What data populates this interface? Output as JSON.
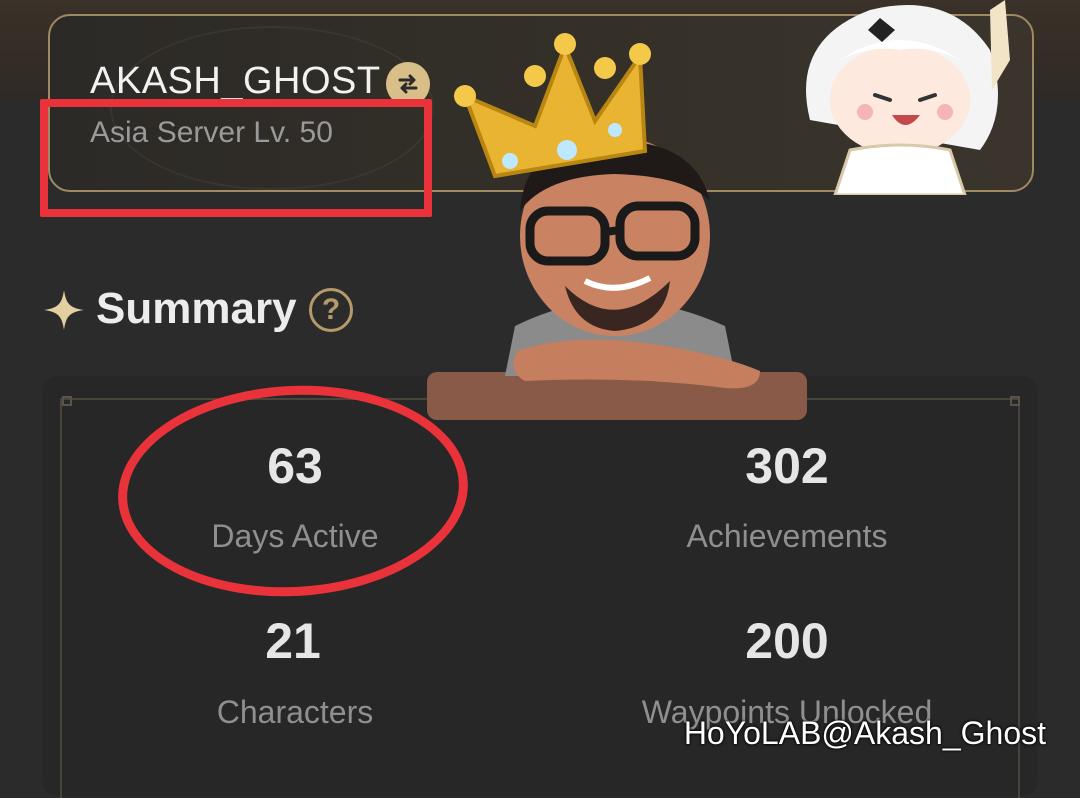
{
  "profile": {
    "username": "AKASH_GHOST",
    "server_level": "Asia Server Lv. 50"
  },
  "summary": {
    "title": "Summary"
  },
  "stats": [
    {
      "value": "63",
      "label": "Days Active"
    },
    {
      "value": "302",
      "label": "Achievements"
    },
    {
      "value": "21",
      "label": "Characters"
    },
    {
      "value": "200",
      "label": "Waypoints Unlocked"
    }
  ],
  "watermark": "HoYoLAB@Akash_Ghost",
  "colors": {
    "background": "#2b2b2b",
    "card_border": "#a08a62",
    "accent_gold": "#d8bf8a",
    "annotation_red": "#e9323a"
  },
  "icons": {
    "swap": "swap-arrows-icon",
    "sparkle": "sparkle-icon",
    "help": "question-circle-icon"
  }
}
